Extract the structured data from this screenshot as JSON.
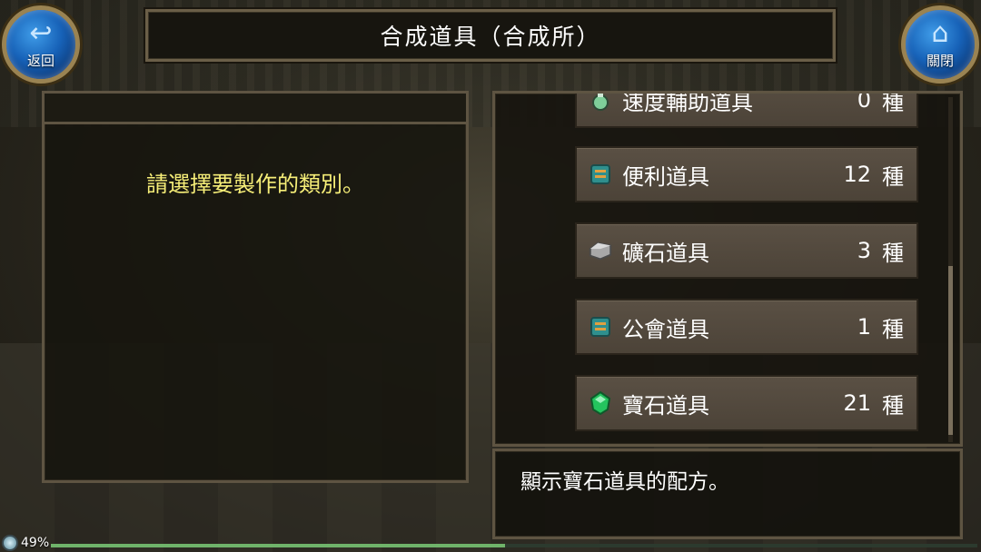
{
  "header": {
    "title": "合成道具（合成所）",
    "back_label": "返回",
    "home_label": "關閉"
  },
  "left_panel": {
    "prompt": "請選擇要製作的類別。"
  },
  "list": {
    "items": [
      {
        "name": "速度輔助道具",
        "count": "0",
        "unit": "種",
        "icon": "potion-icon",
        "color": "#7fcf9a"
      },
      {
        "name": "便利道具",
        "count": "12",
        "unit": "種",
        "icon": "book-icon",
        "color": "#3fa2a0"
      },
      {
        "name": "礦石道具",
        "count": "3",
        "unit": "種",
        "icon": "ore-icon",
        "color": "#b8b8b8"
      },
      {
        "name": "公會道具",
        "count": "1",
        "unit": "種",
        "icon": "book-icon",
        "color": "#3fa2a0"
      },
      {
        "name": "寶石道具",
        "count": "21",
        "unit": "種",
        "icon": "gem-icon",
        "color": "#2fd36b"
      }
    ]
  },
  "description": {
    "text": "顯示寶石道具的配方。"
  },
  "status": {
    "battery_percent": "49%",
    "battery_level": 0.49
  }
}
